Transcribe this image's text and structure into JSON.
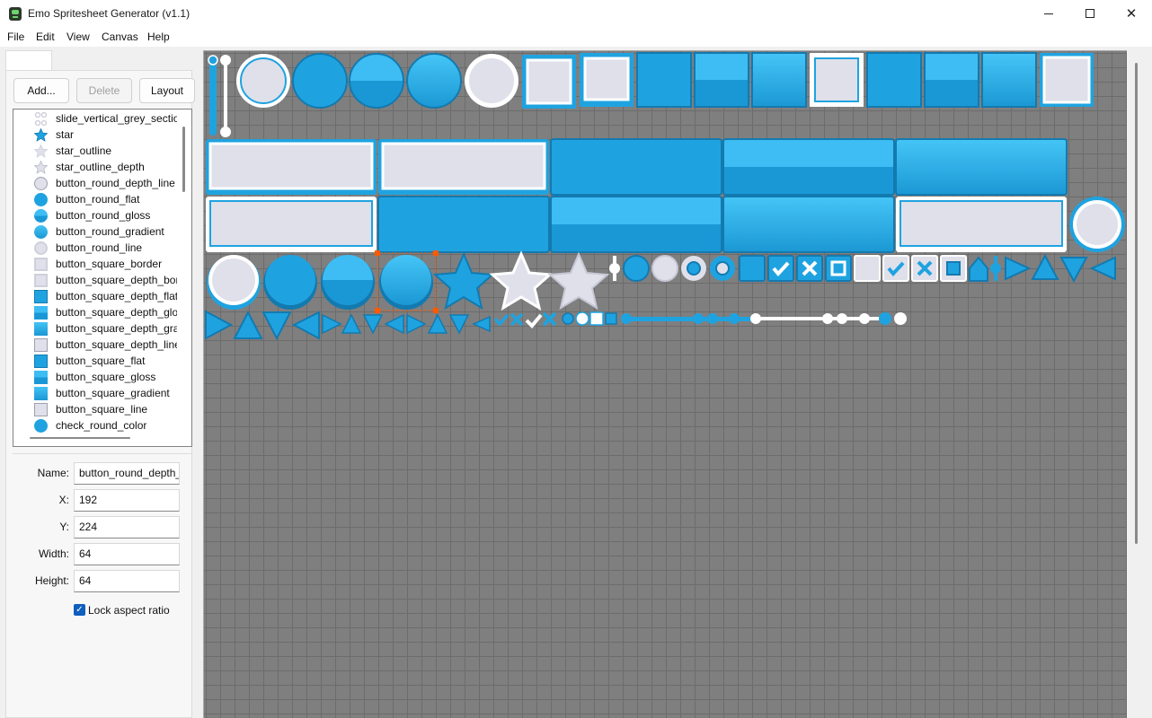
{
  "window": {
    "title": "Emo Spritesheet Generator (v1.1)"
  },
  "menu": [
    "File",
    "Edit",
    "View",
    "Canvas",
    "Help"
  ],
  "toolbar": {
    "add_label": "Add...",
    "delete_label": "Delete",
    "layout_label": "Layout"
  },
  "sprite_list": [
    {
      "label": "slide_vertical_grey_section",
      "icon": "slider-handle-icon"
    },
    {
      "label": "star",
      "icon": "star-icon"
    },
    {
      "label": "star_outline",
      "icon": "star-outline-icon"
    },
    {
      "label": "star_outline_depth",
      "icon": "star-outline-icon"
    },
    {
      "label": "button_round_depth_line",
      "icon": "round-line-icon"
    },
    {
      "label": "button_round_flat",
      "icon": "round-flat-icon"
    },
    {
      "label": "button_round_gloss",
      "icon": "round-gloss-icon"
    },
    {
      "label": "button_round_gradient",
      "icon": "round-gradient-icon"
    },
    {
      "label": "button_round_line",
      "icon": "round-line-icon"
    },
    {
      "label": "button_square_border",
      "icon": "square-border-icon"
    },
    {
      "label": "button_square_depth_border",
      "icon": "square-border-icon"
    },
    {
      "label": "button_square_depth_flat",
      "icon": "square-flat-icon"
    },
    {
      "label": "button_square_depth_gloss",
      "icon": "square-gloss-icon"
    },
    {
      "label": "button_square_depth_gradient",
      "icon": "square-gradient-icon"
    },
    {
      "label": "button_square_depth_line",
      "icon": "square-line-icon"
    },
    {
      "label": "button_square_flat",
      "icon": "square-flat-icon"
    },
    {
      "label": "button_square_gloss",
      "icon": "square-gloss-icon"
    },
    {
      "label": "button_square_gradient",
      "icon": "square-gradient-icon"
    },
    {
      "label": "button_square_line",
      "icon": "square-line-icon"
    },
    {
      "label": "check_round_color",
      "icon": "round-flat-icon"
    }
  ],
  "properties": {
    "name_label": "Name:",
    "name_value": "button_round_depth_",
    "x_label": "X:",
    "x_value": "192",
    "y_label": "Y:",
    "y_value": "224",
    "width_label": "Width:",
    "width_value": "64",
    "height_label": "Height:",
    "height_value": "64",
    "lock_label": "Lock aspect ratio",
    "lock_checked": true
  },
  "colors": {
    "accent": "#1fa3e0",
    "accent_light": "#3dbdf3",
    "sprite_light": "#dfe0ea",
    "selection": "#ff5a00",
    "canvas_bg": "#7f7f7f"
  }
}
